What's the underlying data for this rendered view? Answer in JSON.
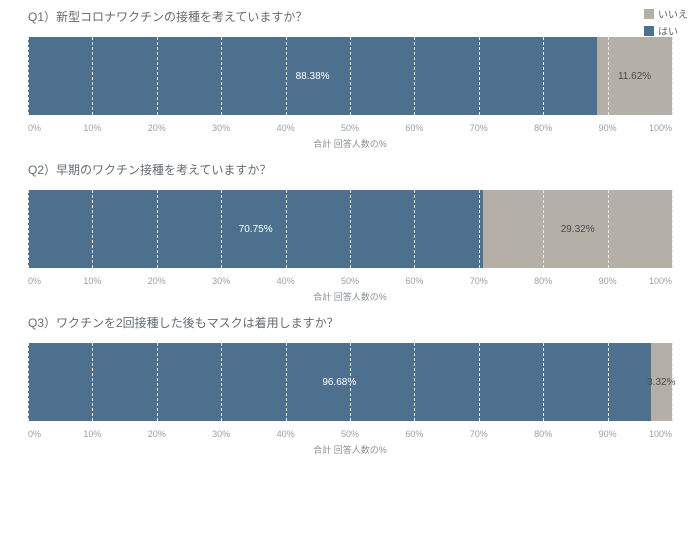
{
  "legend": {
    "no_label": "いいえ",
    "yes_label": "はい",
    "no_color": "#b5b0a7",
    "yes_color": "#4d708f"
  },
  "axis_ticks": [
    "0%",
    "10%",
    "20%",
    "30%",
    "40%",
    "50%",
    "60%",
    "70%",
    "80%",
    "90%",
    "100%"
  ],
  "xlabel": "合計 回答人数の%",
  "questions": [
    {
      "title": "Q1）新型コロナワクチンの接種を考えていますか？",
      "yes_pct": 88.38,
      "no_pct": 11.62,
      "yes_label": "88.38%",
      "no_label": "11.62%"
    },
    {
      "title": "Q2）早期のワクチン接種を考えていますか？",
      "yes_pct": 70.75,
      "no_pct": 29.32,
      "yes_label": "70.75%",
      "no_label": "29.32%"
    },
    {
      "title": "Q3）ワクチンを2回接種した後もマスクは着用しますか？",
      "yes_pct": 96.68,
      "no_pct": 3.32,
      "yes_label": "96.68%",
      "no_label": "3.32%"
    }
  ],
  "chart_data": [
    {
      "type": "bar",
      "orientation": "horizontal-stacked",
      "title": "Q1）新型コロナワクチンの接種を考えていますか？",
      "xlabel": "合計 回答人数の%",
      "xlim": [
        0,
        100
      ],
      "series": [
        {
          "name": "はい",
          "values": [
            88.38
          ]
        },
        {
          "name": "いいえ",
          "values": [
            11.62
          ]
        }
      ]
    },
    {
      "type": "bar",
      "orientation": "horizontal-stacked",
      "title": "Q2）早期のワクチン接種を考えていますか？",
      "xlabel": "合計 回答人数の%",
      "xlim": [
        0,
        100
      ],
      "series": [
        {
          "name": "はい",
          "values": [
            70.75
          ]
        },
        {
          "name": "いいえ",
          "values": [
            29.32
          ]
        }
      ]
    },
    {
      "type": "bar",
      "orientation": "horizontal-stacked",
      "title": "Q3）ワクチンを2回接種した後もマスクは着用しますか？",
      "xlabel": "合計 回答人数の%",
      "xlim": [
        0,
        100
      ],
      "series": [
        {
          "name": "はい",
          "values": [
            96.68
          ]
        },
        {
          "name": "いいえ",
          "values": [
            3.32
          ]
        }
      ]
    }
  ]
}
